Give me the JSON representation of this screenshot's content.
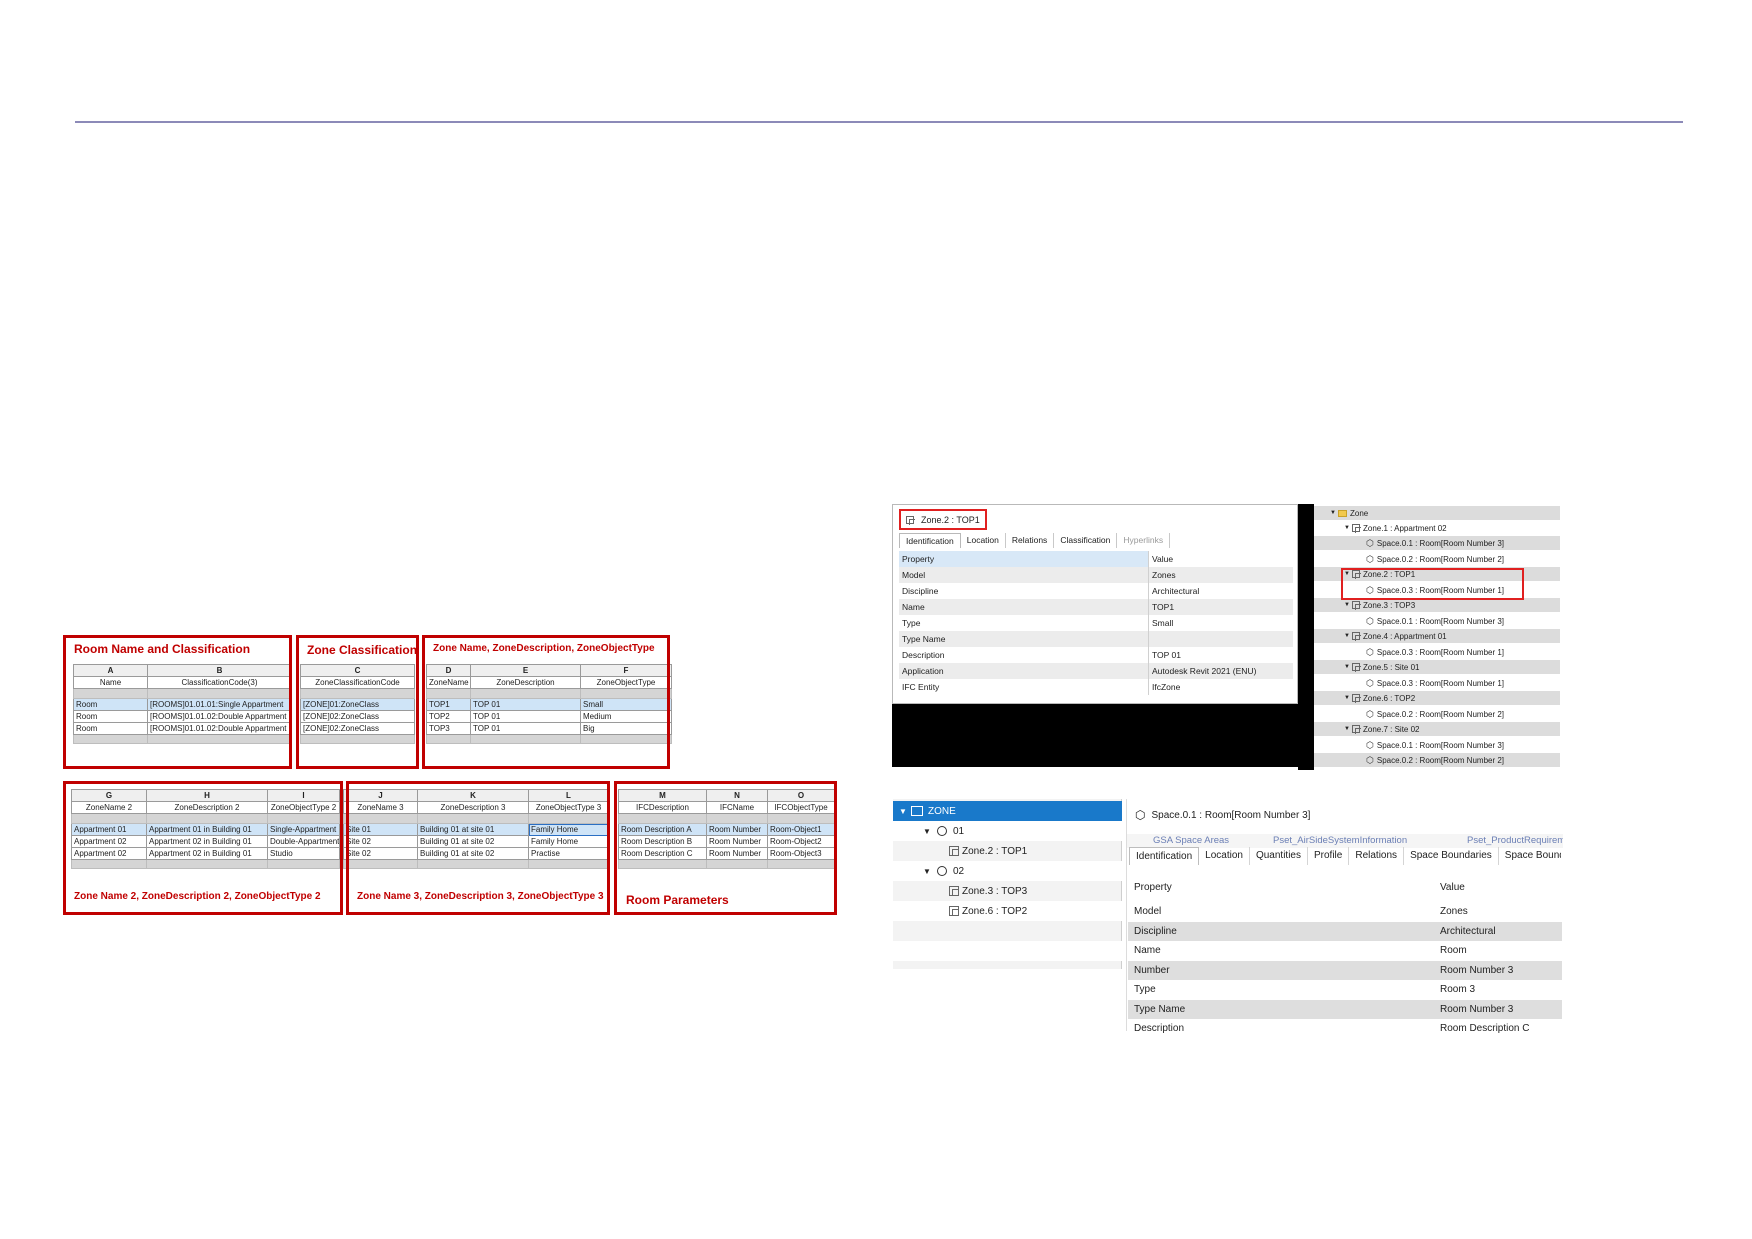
{
  "block1": {
    "title": "Room Name and Classification",
    "letters": [
      "A",
      "B"
    ],
    "headers": [
      "Name",
      "ClassificationCode(3)"
    ],
    "rows": [
      [
        "Room",
        "[ROOMS]01.01.01:Single Appartment"
      ],
      [
        "Room",
        "[ROOMS]01.01.02:Double Appartment"
      ],
      [
        "Room",
        "[ROOMS]01.01.02:Double Appartment"
      ]
    ]
  },
  "block2": {
    "title": "Zone Classification",
    "letters": [
      "C"
    ],
    "headers": [
      "ZoneClassificationCode"
    ],
    "rows": [
      [
        "[ZONE]01:ZoneClass"
      ],
      [
        "[ZONE]02:ZoneClass"
      ],
      [
        "[ZONE]02:ZoneClass"
      ]
    ]
  },
  "block3": {
    "title": "Zone Name, ZoneDescription, ZoneObjectType",
    "letters": [
      "D",
      "E",
      "F"
    ],
    "headers": [
      "ZoneName",
      "ZoneDescription",
      "ZoneObjectType"
    ],
    "rows": [
      [
        "TOP1",
        "TOP 01",
        "Small"
      ],
      [
        "TOP2",
        "TOP 01",
        "Medium"
      ],
      [
        "TOP3",
        "TOP 01",
        "Big"
      ]
    ]
  },
  "block4": {
    "title": "Zone Name 2, ZoneDescription 2, ZoneObjectType 2",
    "letters": [
      "G",
      "H",
      "I"
    ],
    "headers": [
      "ZoneName 2",
      "ZoneDescription 2",
      "ZoneObjectType 2"
    ],
    "rows": [
      [
        "Appartment 01",
        "Appartment 01 in Building 01",
        "Single-Appartment"
      ],
      [
        "Appartment 02",
        "Appartment 02 in Building 01",
        "Double-Appartment"
      ],
      [
        "Appartment 02",
        "Appartment 02 in Building 01",
        "Studio"
      ]
    ]
  },
  "block5": {
    "title": "Zone Name 3, ZoneDescription 3, ZoneObjectType 3",
    "letters": [
      "J",
      "K",
      "L"
    ],
    "headers": [
      "ZoneName 3",
      "ZoneDescription 3",
      "ZoneObjectType 3"
    ],
    "rows": [
      [
        "Site 01",
        "Building 01 at site 01",
        "Family Home"
      ],
      [
        "Site 02",
        "Building 01 at site 02",
        "Family Home"
      ],
      [
        "Site 02",
        "Building 01 at site 02",
        "Practise"
      ]
    ]
  },
  "block6": {
    "title": "Room Parameters",
    "letters": [
      "M",
      "N",
      "O"
    ],
    "headers": [
      "IFCDescription",
      "IFCName",
      "IFCObjectType"
    ],
    "rows": [
      [
        "Room Description A",
        "Room Number",
        "Room-Object1"
      ],
      [
        "Room Description B",
        "Room Number",
        "Room-Object2"
      ],
      [
        "Room Description C",
        "Room Number",
        "Room-Object3"
      ]
    ]
  },
  "props_top": {
    "title": "Zone.2 : TOP1",
    "tabs": [
      "Identification",
      "Location",
      "Relations",
      "Classification",
      "Hyperlinks"
    ],
    "header": [
      "Property",
      "Value"
    ],
    "rows": [
      [
        "Model",
        "Zones"
      ],
      [
        "Discipline",
        "Architectural"
      ],
      [
        "Name",
        "TOP1"
      ],
      [
        "Type",
        "Small"
      ],
      [
        "Type Name",
        ""
      ],
      [
        "Description",
        "TOP 01"
      ],
      [
        "Application",
        "Autodesk Revit 2021 (ENU)"
      ],
      [
        "IFC Entity",
        "IfcZone"
      ]
    ]
  },
  "tree_top": [
    {
      "label": "Zone",
      "icon": "folder",
      "level": 0
    },
    {
      "label": "Zone.1 : Appartment 02",
      "icon": "zone",
      "level": 1
    },
    {
      "label": "Space.0.1 : Room[Room Number 3]",
      "icon": "cube",
      "level": 2
    },
    {
      "label": "Space.0.2 : Room[Room Number 2]",
      "icon": "cube",
      "level": 2
    },
    {
      "label": "Zone.2 : TOP1",
      "icon": "zone",
      "level": 1
    },
    {
      "label": "Space.0.3 : Room[Room Number 1]",
      "icon": "cube",
      "level": 2
    },
    {
      "label": "Zone.3 : TOP3",
      "icon": "zone",
      "level": 1
    },
    {
      "label": "Space.0.1 : Room[Room Number 3]",
      "icon": "cube",
      "level": 2
    },
    {
      "label": "Zone.4 : Appartment 01",
      "icon": "zone",
      "level": 1
    },
    {
      "label": "Space.0.3 : Room[Room Number 1]",
      "icon": "cube",
      "level": 2
    },
    {
      "label": "Zone.5 : Site 01",
      "icon": "zone",
      "level": 1
    },
    {
      "label": "Space.0.3 : Room[Room Number 1]",
      "icon": "cube",
      "level": 2
    },
    {
      "label": "Zone.6 : TOP2",
      "icon": "zone",
      "level": 1
    },
    {
      "label": "Space.0.2 : Room[Room Number 2]",
      "icon": "cube",
      "level": 2
    },
    {
      "label": "Zone.7 : Site 02",
      "icon": "zone",
      "level": 1
    },
    {
      "label": "Space.0.1 : Room[Room Number 3]",
      "icon": "cube",
      "level": 2
    },
    {
      "label": "Space.0.2 : Room[Room Number 2]",
      "icon": "cube",
      "level": 2
    }
  ],
  "tree_bottom": {
    "root": "ZONE",
    "group1": "01",
    "item1": "Zone.2 : TOP1",
    "group2": "02",
    "item2": "Zone.3 : TOP3",
    "item3": "Zone.6 : TOP2"
  },
  "props_bottom": {
    "title": "Space.0.1 : Room[Room Number 3]",
    "psets": [
      "GSA Space Areas",
      "Pset_AirSideSystemInformation",
      "Pset_ProductRequirements"
    ],
    "tabs": [
      "Identification",
      "Location",
      "Quantities",
      "Profile",
      "Relations",
      "Space Boundaries",
      "Space Boundaries"
    ],
    "header": [
      "Property",
      "Value"
    ],
    "rows": [
      [
        "Model",
        "Zones"
      ],
      [
        "Discipline",
        "Architectural"
      ],
      [
        "Name",
        "Room"
      ],
      [
        "Number",
        "Room Number 3"
      ],
      [
        "Type",
        "Room 3"
      ],
      [
        "Type Name",
        "Room Number 3"
      ],
      [
        "Description",
        "Room Description C"
      ]
    ]
  }
}
